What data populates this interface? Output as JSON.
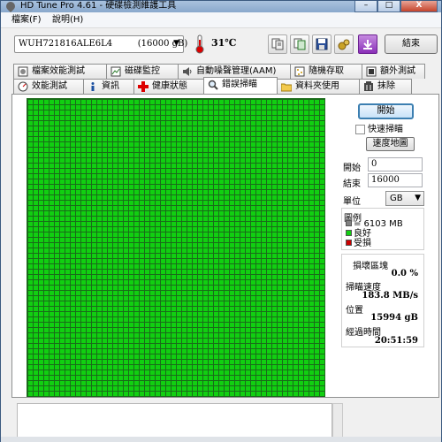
{
  "window": {
    "title": "HD Tune Pro 4.61 - 硬碟檢測維護工具",
    "minimize": "–",
    "maximize": "□",
    "close": "X"
  },
  "menu": {
    "file": "檔案(F)",
    "help": "說明(H)"
  },
  "toolbar": {
    "drive": "WUH721816ALE6L4         (16000 gB)",
    "temperature": "31℃",
    "exit_label": "結束",
    "buttons": [
      "copy-info-icon",
      "copy-screenshot-icon",
      "save-icon",
      "options-icon",
      "download-icon"
    ]
  },
  "tabs_row1": [
    {
      "label": "檔案效能測試",
      "icon": "file-benchmark-icon"
    },
    {
      "label": "磁碟監控",
      "icon": "disk-monitor-icon"
    },
    {
      "label": "自動噪聲管理(AAM)",
      "icon": "speaker-icon"
    },
    {
      "label": "隨機存取",
      "icon": "random-access-icon"
    },
    {
      "label": "額外測試",
      "icon": "extra-tests-icon"
    }
  ],
  "tabs_row2": [
    {
      "label": "效能測試",
      "icon": "benchmark-icon"
    },
    {
      "label": "資訊",
      "icon": "info-icon"
    },
    {
      "label": "健康狀態",
      "icon": "health-icon"
    },
    {
      "label": "錯誤掃瞄",
      "icon": "magnifier-icon"
    },
    {
      "label": "資料夾使用",
      "icon": "folder-icon"
    },
    {
      "label": "抹除",
      "icon": "erase-icon"
    }
  ],
  "active_tab": "錯誤掃瞄",
  "scan": {
    "start_button": "開始",
    "quick_scan_label": "快速掃瞄",
    "quick_scan_checked": false,
    "speed_map_button": "速度地圖",
    "start_label": "開始",
    "start_value": "0",
    "end_label": "結束",
    "end_value": "16000",
    "unit_label": "單位",
    "unit_value": "GB"
  },
  "legend": {
    "title": "圖例",
    "block_size": "= 6103 MB",
    "good": "良好",
    "damaged": "受損",
    "colors": {
      "block": "#808080",
      "good": "#11cf11",
      "damaged": "#cc0000"
    }
  },
  "stats": {
    "damaged_blocks_label": "損壞區塊",
    "damaged_blocks_value": "0.0 %",
    "scan_speed_label": "掃瞄速度",
    "scan_speed_value": "183.8 MB/s",
    "position_label": "位置",
    "position_value": "15994 gB",
    "elapsed_label": "經過時間",
    "elapsed_value": "20:51:59"
  },
  "grid_colors": {
    "cell": "#11cf11",
    "line": "#1a6b1a"
  }
}
